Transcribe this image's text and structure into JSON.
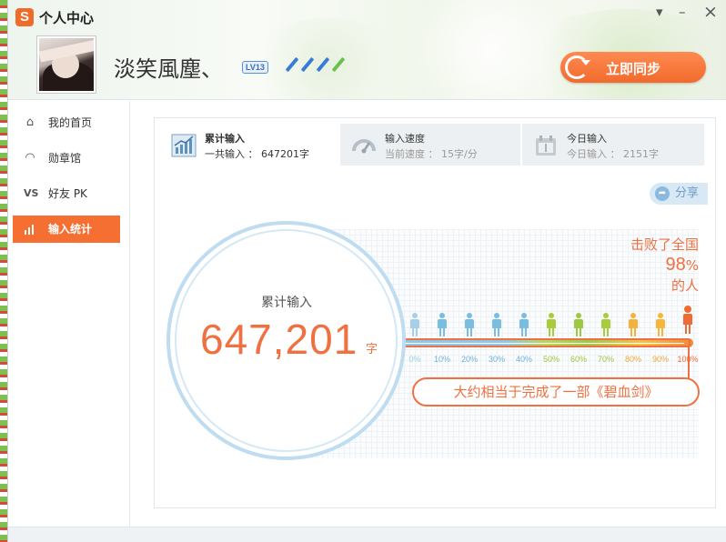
{
  "window": {
    "app_logo": "S",
    "title": "个人中心",
    "controls": {
      "dropdown": "▾",
      "minimize": "–",
      "close": "×"
    }
  },
  "profile": {
    "username": "淡笑風塵、",
    "level_badge": "LV13",
    "pen_colors": [
      "#3a7bd5",
      "#3a7bd5",
      "#3a7bd5",
      "#6cc04a"
    ],
    "sync_button": "立即同步"
  },
  "sidebar": {
    "items": [
      {
        "label": "我的首页",
        "icon": "home-icon",
        "active": false
      },
      {
        "label": "勋章馆",
        "icon": "medal-icon",
        "active": false
      },
      {
        "label": "好友 PK",
        "icon": "vs-icon",
        "active": false
      },
      {
        "label": "输入统计",
        "icon": "bar-chart-icon",
        "active": true
      }
    ]
  },
  "tabs": [
    {
      "title": "累计输入",
      "subtitle": "一共输入 ： 647201字",
      "icon": "trend-chart-icon",
      "active": true
    },
    {
      "title": "输入速度",
      "subtitle": "当前速度 ： 15字/分",
      "icon": "speedometer-icon",
      "active": false
    },
    {
      "title": "今日输入",
      "subtitle": "今日输入 ： 2151字",
      "icon": "calendar-icon",
      "active": false
    }
  ],
  "share": {
    "label": "分享",
    "icon": "share-arrow-icon"
  },
  "stats": {
    "circle_label": "累计输入",
    "total_number": "647,201",
    "unit": "字",
    "beat_prefix": "击败了全国",
    "beat_percent": "98",
    "beat_percent_sign": "%",
    "beat_suffix": "的人",
    "percentile_value": 98,
    "scale_labels": [
      "0%",
      "10%",
      "20%",
      "30%",
      "40%",
      "50%",
      "60%",
      "70%",
      "80%",
      "90%",
      "100%"
    ],
    "person_colors": [
      "#a8cfe8",
      "#79bde0",
      "#79bde0",
      "#79bde0",
      "#79bde0",
      "#a9cc3a",
      "#9cc93f",
      "#a9cc3a",
      "#f2b23b",
      "#f5b63a",
      "#ef6b35"
    ],
    "label_colors": [
      "#9fc9e6",
      "#6fb0da",
      "#6fb0da",
      "#6fb0da",
      "#6fb0da",
      "#9cc43c",
      "#9cc43c",
      "#9cc43c",
      "#eda73a",
      "#eda73a",
      "#ef6b35"
    ],
    "equivalent_text": "大约相当于完成了一部《碧血剑》"
  },
  "colors": {
    "accent": "#f46f31",
    "ring": "#bfdcf0"
  }
}
